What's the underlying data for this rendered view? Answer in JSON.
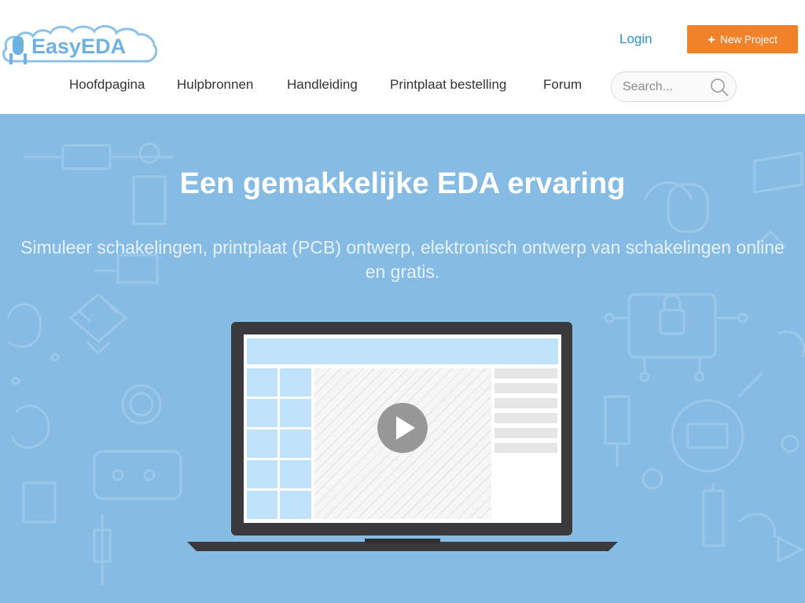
{
  "header": {
    "logo_text": "EasyEDA",
    "login_label": "Login",
    "new_project_label": "New Project",
    "nav": [
      {
        "label": "Hoofdpagina"
      },
      {
        "label": "Hulpbronnen"
      },
      {
        "label": "Handleiding"
      },
      {
        "label": "Printplaat bestelling"
      },
      {
        "label": "Forum"
      }
    ],
    "search": {
      "placeholder": "Search..."
    }
  },
  "hero": {
    "title": "Een gemakkelijke EDA ervaring",
    "subtitle": "Simuleer schakelingen, printplaat (PCB) ontwerp, elektronisch ontwerp van schakelingen online en gratis."
  },
  "colors": {
    "accent": "#f2822a",
    "link": "#2a95c9",
    "hero_bg": "#86bbe3",
    "logo": "#6fb1e0"
  },
  "icons": {
    "search": "search-icon",
    "play": "play-icon",
    "plus": "plus-icon"
  }
}
